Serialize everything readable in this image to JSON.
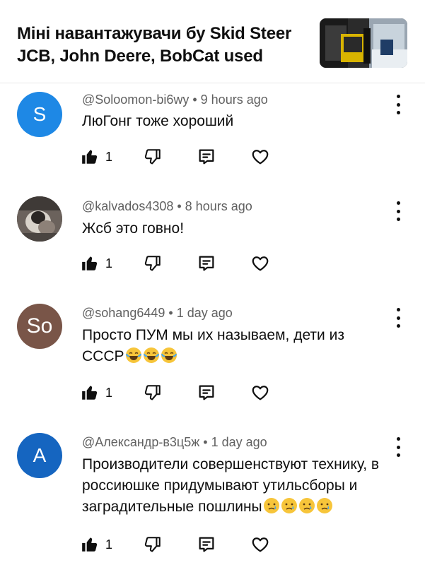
{
  "header": {
    "title": "Міні навантажувачи бу Skid Steer JCB, John Deere, BobCat used"
  },
  "comments": [
    {
      "avatar_letter": "S",
      "avatar_color": "#1e88e5",
      "author": "@Soloomon-bi6wy",
      "time": "9 hours ago",
      "text": "ЛюГонг тоже хороший",
      "emojis": [],
      "likes": "1"
    },
    {
      "avatar_letter": "",
      "avatar_type": "photo",
      "author": "@kalvados4308",
      "time": "8 hours ago",
      "text": "Жсб это говно!",
      "emojis": [],
      "likes": "1"
    },
    {
      "avatar_letter": "So",
      "avatar_color": "#795548",
      "author": "@sohang6449",
      "time": "1 day ago",
      "text": "Просто ПУМ мы их называем, дети из СССР",
      "emojis": [
        "face-with-tears-of-joy",
        "face-with-tears-of-joy",
        "face-with-tears-of-joy"
      ],
      "likes": "1"
    },
    {
      "avatar_letter": "А",
      "avatar_color": "#1565c0",
      "author": "@Александр-в3ц5ж",
      "time": "1 day ago",
      "text": "Производители совершенствуют технику, в россиюшке придумывают утильсборы и заградительные пошлины",
      "emojis": [
        "crying-face",
        "crying-face",
        "crying-face",
        "crying-face"
      ],
      "likes": "1"
    }
  ],
  "separator": " • "
}
